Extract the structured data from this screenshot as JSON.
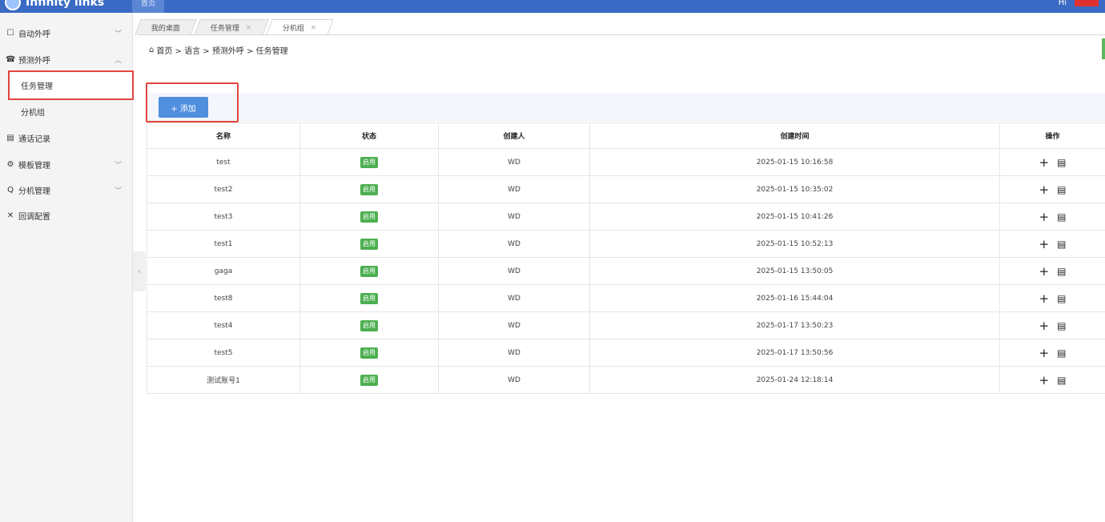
{
  "topbar": {
    "brand": "Infinity links",
    "tab_label": "首页",
    "user": "Hi"
  },
  "sidebar": {
    "items": [
      {
        "label": "自动外呼",
        "icon": "☐",
        "chevron": "﹀"
      },
      {
        "label": "预测外呼",
        "icon": "☎",
        "chevron": "︿"
      },
      {
        "label": "任务管理"
      },
      {
        "label": "分机组"
      },
      {
        "label": "通话记录",
        "icon": "▤"
      },
      {
        "label": "模板管理",
        "icon": "⚙",
        "chevron": "﹀"
      },
      {
        "label": "分机管理",
        "icon": "Q",
        "chevron": "﹀"
      },
      {
        "label": "回调配置",
        "icon": "✕"
      }
    ],
    "collapse_glyph": "‹"
  },
  "tabs": [
    {
      "label": "我的桌面"
    },
    {
      "label": "任务管理",
      "close": "×"
    },
    {
      "label": "分机组",
      "close": "×"
    }
  ],
  "breadcrumb": {
    "home_icon": "⌂",
    "path": "首页 > 语言 > 预测外呼 > 任务管理"
  },
  "toolbar": {
    "add_label": "+ 添加"
  },
  "table": {
    "headers": [
      "名称",
      "状态",
      "创建人",
      "创建时间",
      "操作"
    ],
    "rows": [
      {
        "name": "test",
        "status": "启用",
        "creator": "WD",
        "created": "2025-01-15 10:16:58"
      },
      {
        "name": "test2",
        "status": "启用",
        "creator": "WD",
        "created": "2025-01-15 10:35:02"
      },
      {
        "name": "test3",
        "status": "启用",
        "creator": "WD",
        "created": "2025-01-15 10:41:26"
      },
      {
        "name": "test1",
        "status": "启用",
        "creator": "WD",
        "created": "2025-01-15 10:52:13"
      },
      {
        "name": "gaga",
        "status": "启用",
        "creator": "WD",
        "created": "2025-01-15 13:50:05"
      },
      {
        "name": "test8",
        "status": "启用",
        "creator": "WD",
        "created": "2025-01-16 15:44:04"
      },
      {
        "name": "test4",
        "status": "启用",
        "creator": "WD",
        "created": "2025-01-17 13:50:23"
      },
      {
        "name": "test5",
        "status": "启用",
        "creator": "WD",
        "created": "2025-01-17 13:50:56"
      },
      {
        "name": "测试账号1",
        "status": "启用",
        "creator": "WD",
        "created": "2025-01-24 12:18:14"
      }
    ],
    "op_add": "+",
    "op_doc": "▤"
  },
  "colors": {
    "primary": "#3a6bc4",
    "button": "#4f8fde",
    "status_green": "#4caf50",
    "highlight_red": "#e3443d"
  }
}
